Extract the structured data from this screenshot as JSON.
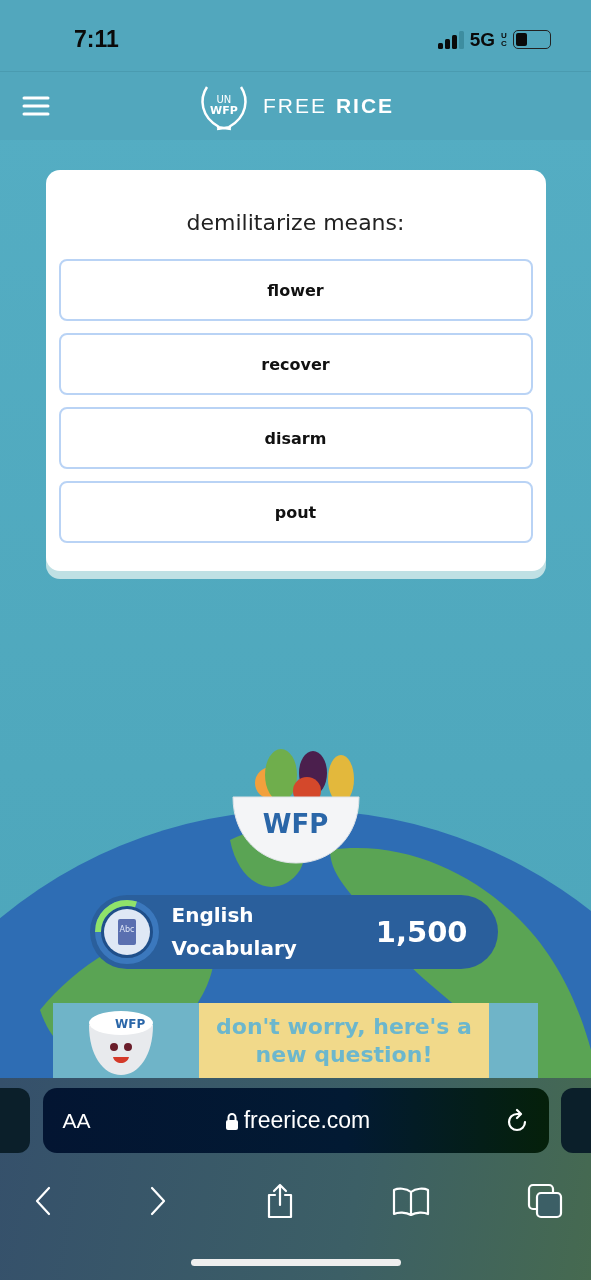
{
  "status_bar": {
    "time": "7:11",
    "network": "5G",
    "network_suffix": "UC",
    "battery": {
      "level": 0.35
    }
  },
  "header": {
    "logo_top": "UN",
    "logo_bottom": "WFP",
    "brand_light": "FREE",
    "brand_bold": "RICE"
  },
  "question": {
    "prompt": "demilitarize means:",
    "options": [
      {
        "label": "flower"
      },
      {
        "label": "recover"
      },
      {
        "label": "disarm"
      },
      {
        "label": "pout"
      }
    ]
  },
  "bowl": {
    "label": "WFP"
  },
  "score": {
    "category_icon_text": "Abc",
    "category": "English Vocabulary",
    "progress": {
      "level": 0.3
    },
    "rice": "1,500"
  },
  "banner": {
    "mascot_label": "WFP",
    "message": "don't worry, here's a new question!"
  },
  "browser": {
    "text_size": "AA",
    "url": "freerice.com"
  }
}
